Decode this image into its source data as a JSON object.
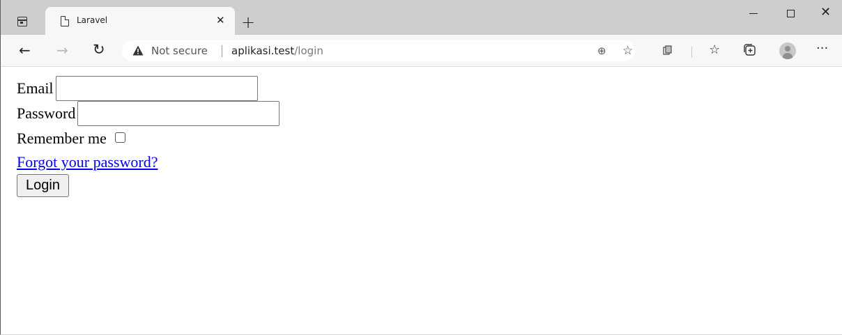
{
  "browser": {
    "tab": {
      "title": "Laravel",
      "close_label": "✕"
    },
    "new_tab_label": "+",
    "window_controls": {
      "minimize": "",
      "maximize": "",
      "close": "✕"
    },
    "nav": {
      "back": "←",
      "forward": "→",
      "reload": "↻"
    },
    "address": {
      "security_text": "Not secure",
      "host": "aplikasi.test",
      "path": "/login"
    },
    "toolbar_icons": [
      "zoom-icon",
      "add-favorite-icon",
      "extension-icon",
      "favorites-icon",
      "collections-icon",
      "profile-icon",
      "more-icon"
    ],
    "more_label": "···"
  },
  "form": {
    "email_label": "Email",
    "email_value": "",
    "password_label": "Password",
    "password_value": "",
    "remember_label": "Remember me",
    "remember_checked": false,
    "forgot_link": "Forgot your password?",
    "login_button": "Login"
  }
}
